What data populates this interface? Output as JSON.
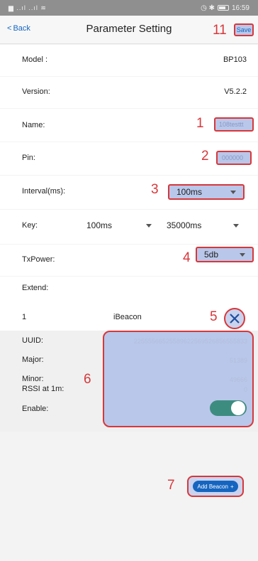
{
  "status": {
    "left": "▄▀▕ ▖▗▘ ▙",
    "right_time": "16:59",
    "right_icons": "⏰ ✳"
  },
  "nav": {
    "back": "Back",
    "title": "Parameter Setting",
    "save": "Save"
  },
  "fields": {
    "model_label": "Model :",
    "model_value": "BP103",
    "version_label": "Version:",
    "version_value": "V5.2.2",
    "name_label": "Name:",
    "name_value": "108testtt",
    "pin_label": "Pin:",
    "pin_value": "000000",
    "interval_label": "Interval(ms):",
    "interval_value": "100ms",
    "key_label": "Key:",
    "key_value1": "100ms",
    "key_value2": "35000ms",
    "txpower_label": "TxPower:",
    "txpower_value": "5db",
    "extend_label": "Extend:"
  },
  "beacon": {
    "index": "1",
    "type": "iBeacon",
    "uuid_label": "UUID:",
    "uuid_value": "22555566525589622569526856555833",
    "major_label": "Major:",
    "major_value": "51389",
    "minor_label": "Minor:",
    "minor_value": "49666",
    "rssi_label": "RSSI at 1m:",
    "rssi_value": "0",
    "enable_label": "Enable:",
    "enable_on": true
  },
  "add_beacon": "Add Beacon",
  "annotations": {
    "n1": "1",
    "n2": "2",
    "n3": "3",
    "n4": "4",
    "n5": "5",
    "n6": "6",
    "n7": "7",
    "n11": "11"
  },
  "colors": {
    "accent": "#1565c0",
    "annotation": "#d8373a",
    "highlight": "#b9c7ea",
    "toggle": "#3d8c80"
  }
}
